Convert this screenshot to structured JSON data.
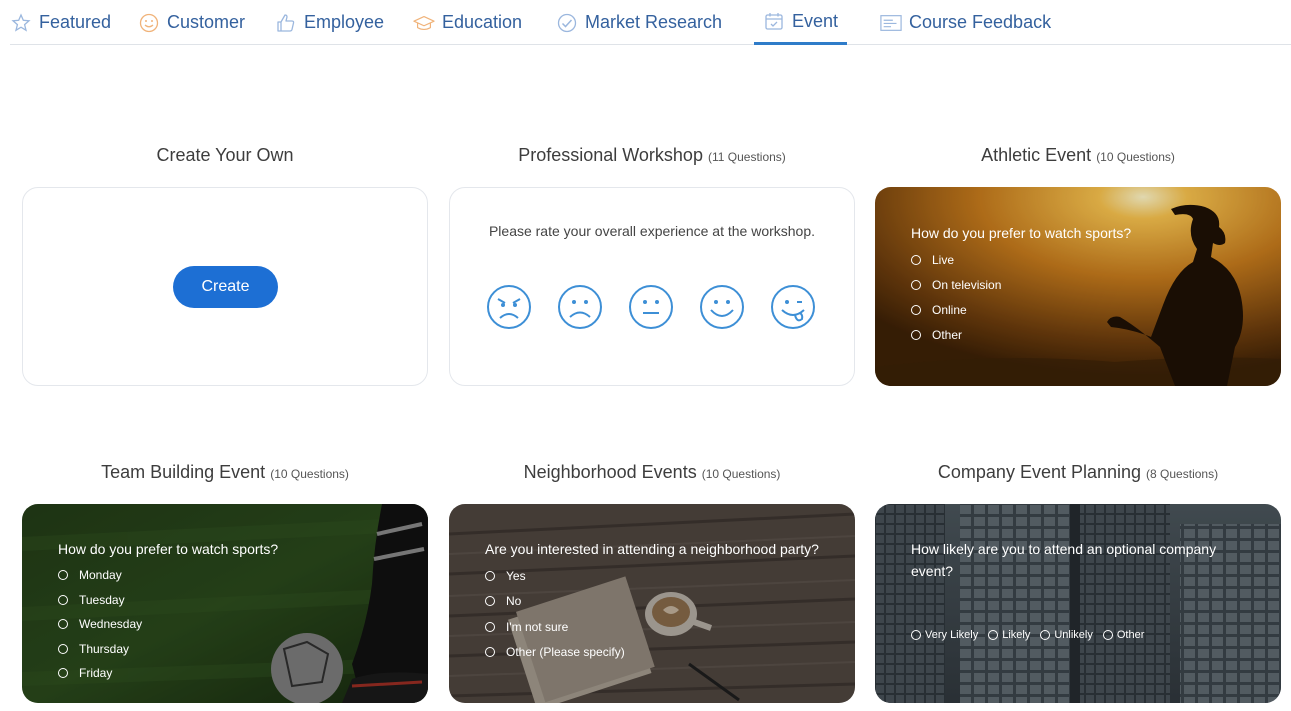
{
  "tabs": [
    {
      "label": "Featured",
      "icon": "star-icon"
    },
    {
      "label": "Customer",
      "icon": "smiley-icon"
    },
    {
      "label": "Employee",
      "icon": "thumbs-up-icon"
    },
    {
      "label": "Education",
      "icon": "graduation-cap-icon"
    },
    {
      "label": "Market Research",
      "icon": "chart-check-icon"
    },
    {
      "label": "Event",
      "icon": "calendar-icon",
      "active": true
    },
    {
      "label": "Course Feedback",
      "icon": "form-icon"
    }
  ],
  "colors": {
    "tab_text": "#34619e",
    "tab_active_underline": "#2f7cc9",
    "create_button": "#1d6fd4",
    "face_icon": "#3d8fd6"
  },
  "cards": {
    "create": {
      "title": "Create Your Own",
      "button": "Create"
    },
    "workshop": {
      "title": "Professional Workshop",
      "count": "(11 Questions)",
      "question": "Please rate your overall experience at the workshop.",
      "faces": [
        "angry-face-icon",
        "sad-face-icon",
        "neutral-face-icon",
        "happy-face-icon",
        "playful-face-icon"
      ]
    },
    "athletic": {
      "title": "Athletic Event",
      "count": "(10 Questions)",
      "question": "How do you prefer to watch sports?",
      "options": [
        "Live",
        "On television",
        "Online",
        "Other"
      ]
    },
    "team": {
      "title": "Team Building Event",
      "count": "(10 Questions)",
      "question": "How do you prefer to watch sports?",
      "options": [
        "Monday",
        "Tuesday",
        "Wednesday",
        "Thursday",
        "Friday"
      ]
    },
    "neighborhood": {
      "title": "Neighborhood Events",
      "count": "(10 Questions)",
      "question": "Are you interested in attending a neighborhood party?",
      "options": [
        "Yes",
        "No",
        "I'm not sure",
        "Other (Please specify)"
      ]
    },
    "company": {
      "title": "Company Event Planning",
      "count": "(8 Questions)",
      "question": "How likely are you to attend an optional company event?",
      "options": [
        "Very Likely",
        "Likely",
        "Unlikely",
        "Other"
      ]
    }
  }
}
